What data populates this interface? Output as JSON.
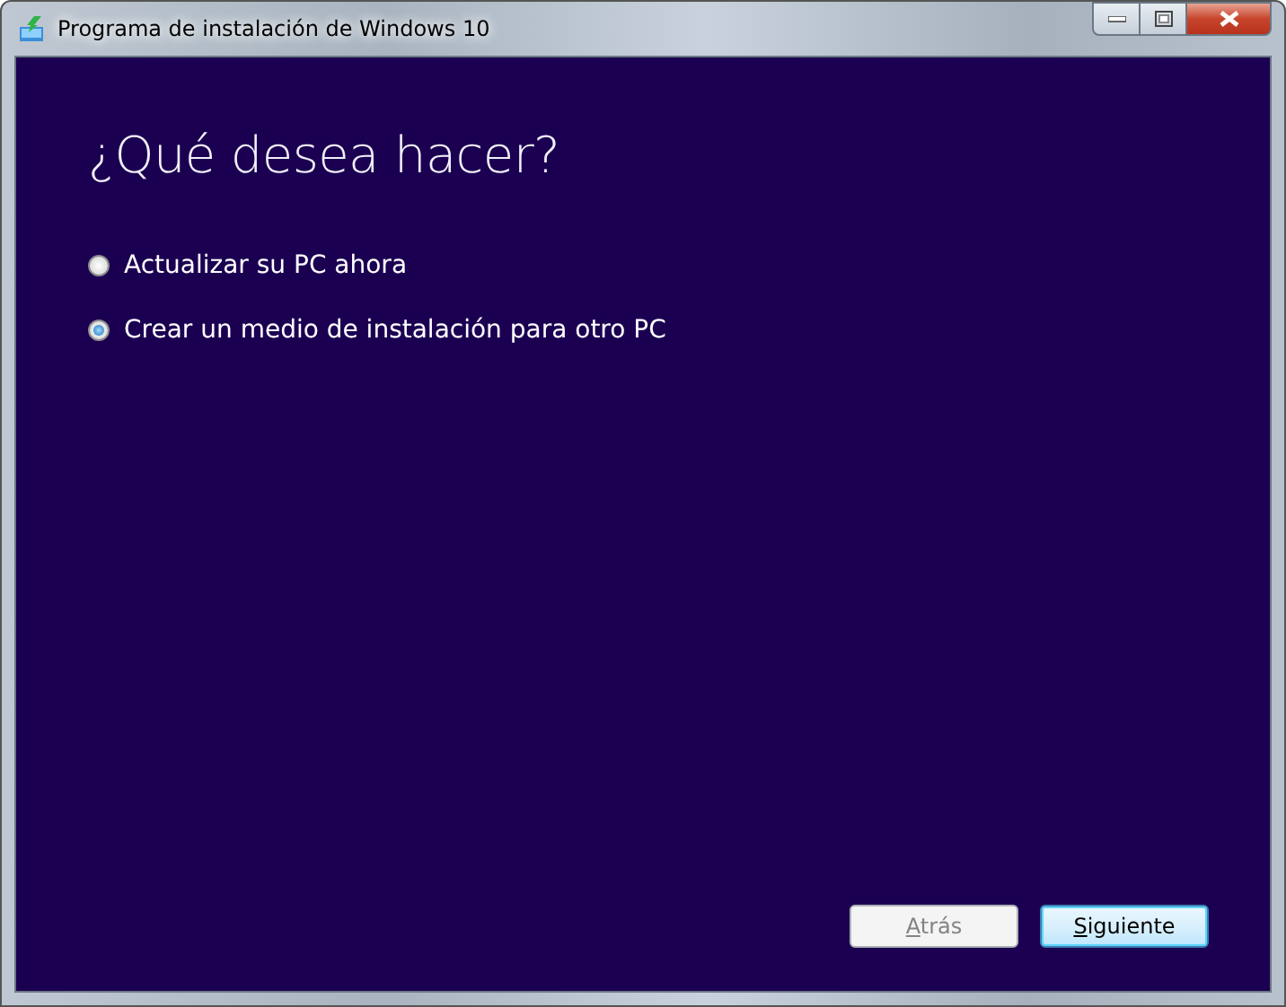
{
  "window": {
    "title": "Programa de instalación de Windows 10",
    "controls": [
      {
        "kind": "minimize"
      },
      {
        "kind": "maximize"
      },
      {
        "kind": "close"
      }
    ]
  },
  "heading": "¿Qué desea hacer?",
  "options": [
    {
      "label": "Actualizar su PC ahora",
      "selected": false
    },
    {
      "label": "Crear un medio de instalación para otro PC",
      "selected": true
    }
  ],
  "buttons": [
    {
      "label": "Atrás",
      "disabled": true,
      "default": false,
      "underline_first": true
    },
    {
      "label": "Siguiente",
      "disabled": false,
      "default": true,
      "underline_first": true
    }
  ]
}
